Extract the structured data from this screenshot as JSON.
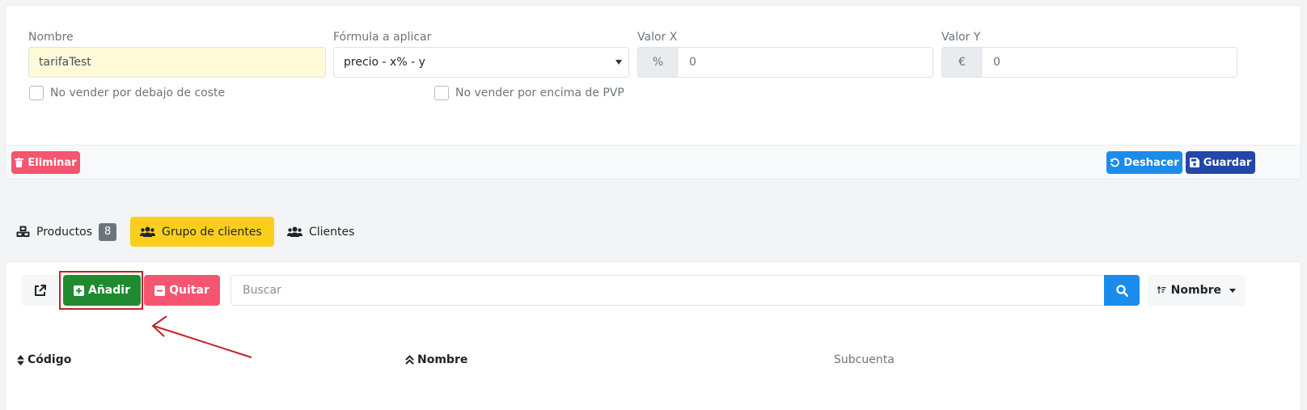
{
  "form": {
    "nombre_label": "Nombre",
    "nombre_value": "tarifaTest",
    "formula_label": "Fórmula a aplicar",
    "formula_value": "precio - x% - y",
    "valorx_label": "Valor X",
    "valorx_addon": "%",
    "valorx_value": "0",
    "valory_label": "Valor Y",
    "valory_addon": "€",
    "valory_value": "0",
    "check1_label": "No vender por debajo de coste",
    "check2_label": "No vender por encima de PVP"
  },
  "footer": {
    "delete_label": "Eliminar",
    "undo_label": "Deshacer",
    "save_label": "Guardar"
  },
  "tabs": [
    {
      "label": "Productos",
      "badge": "8"
    },
    {
      "label": "Grupo de clientes"
    },
    {
      "label": "Clientes"
    }
  ],
  "toolbar": {
    "add_label": "Añadir",
    "remove_label": "Quitar",
    "search_placeholder": "Buscar",
    "sort_label": "Nombre"
  },
  "table": {
    "columns": [
      "Código",
      "Nombre",
      "Subcuenta"
    ]
  },
  "colors": {
    "danger": "#f5556e",
    "info": "#1b8cec",
    "primary": "#2247a8",
    "success": "#1f8a2f",
    "warning": "#fccf1d",
    "annotation": "#c0242c"
  }
}
